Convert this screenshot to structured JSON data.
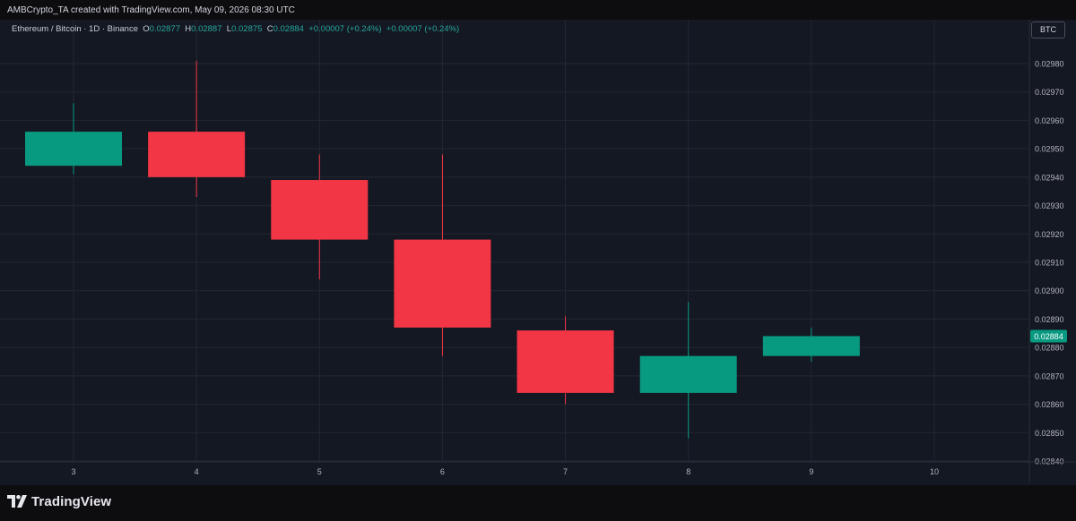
{
  "header": {
    "credit": "AMBCrypto_TA created with TradingView.com, May 09, 2026 08:30 UTC"
  },
  "legend": {
    "symbol": "Ethereum / Bitcoin · 1D · Binance",
    "open_label": "O",
    "open_value": "0.02877",
    "high_label": "H",
    "high_value": "0.02887",
    "low_label": "L",
    "low_value": "0.02875",
    "close_label": "C",
    "close_value": "0.02884",
    "change": "+0.00007 (+0.24%)",
    "change2": "+0.00007 (+0.24%)"
  },
  "currency_button": "BTC",
  "last_price_label": "0.02884",
  "footer": {
    "brand": "TradingView"
  },
  "colors": {
    "up": "#089981",
    "down": "#f23645",
    "background": "#141823",
    "grid": "#232733",
    "axis_text": "#b2b5be"
  },
  "chart_data": {
    "type": "candlestick",
    "x_ticks": [
      "3",
      "4",
      "5",
      "6",
      "7",
      "8",
      "9",
      "10"
    ],
    "y_ticks": [
      "0.02840",
      "0.02850",
      "0.02860",
      "0.02870",
      "0.02880",
      "0.02890",
      "0.02900",
      "0.02910",
      "0.02920",
      "0.02930",
      "0.02940",
      "0.02950",
      "0.02960",
      "0.02970",
      "0.02980"
    ],
    "ylim": [
      0.02839,
      0.02988
    ],
    "grid": true,
    "candles": [
      {
        "day": "3",
        "open": 0.02944,
        "high": 0.02966,
        "low": 0.02941,
        "close": 0.02956
      },
      {
        "day": "4",
        "open": 0.02956,
        "high": 0.02981,
        "low": 0.02933,
        "close": 0.0294
      },
      {
        "day": "5",
        "open": 0.02939,
        "high": 0.02948,
        "low": 0.02904,
        "close": 0.02918
      },
      {
        "day": "6",
        "open": 0.02918,
        "high": 0.02948,
        "low": 0.02877,
        "close": 0.02887
      },
      {
        "day": "7",
        "open": 0.02886,
        "high": 0.02891,
        "low": 0.0286,
        "close": 0.02864
      },
      {
        "day": "8",
        "open": 0.02864,
        "high": 0.02896,
        "low": 0.02848,
        "close": 0.02877
      },
      {
        "day": "9",
        "open": 0.02877,
        "high": 0.02887,
        "low": 0.02875,
        "close": 0.02884
      }
    ]
  }
}
